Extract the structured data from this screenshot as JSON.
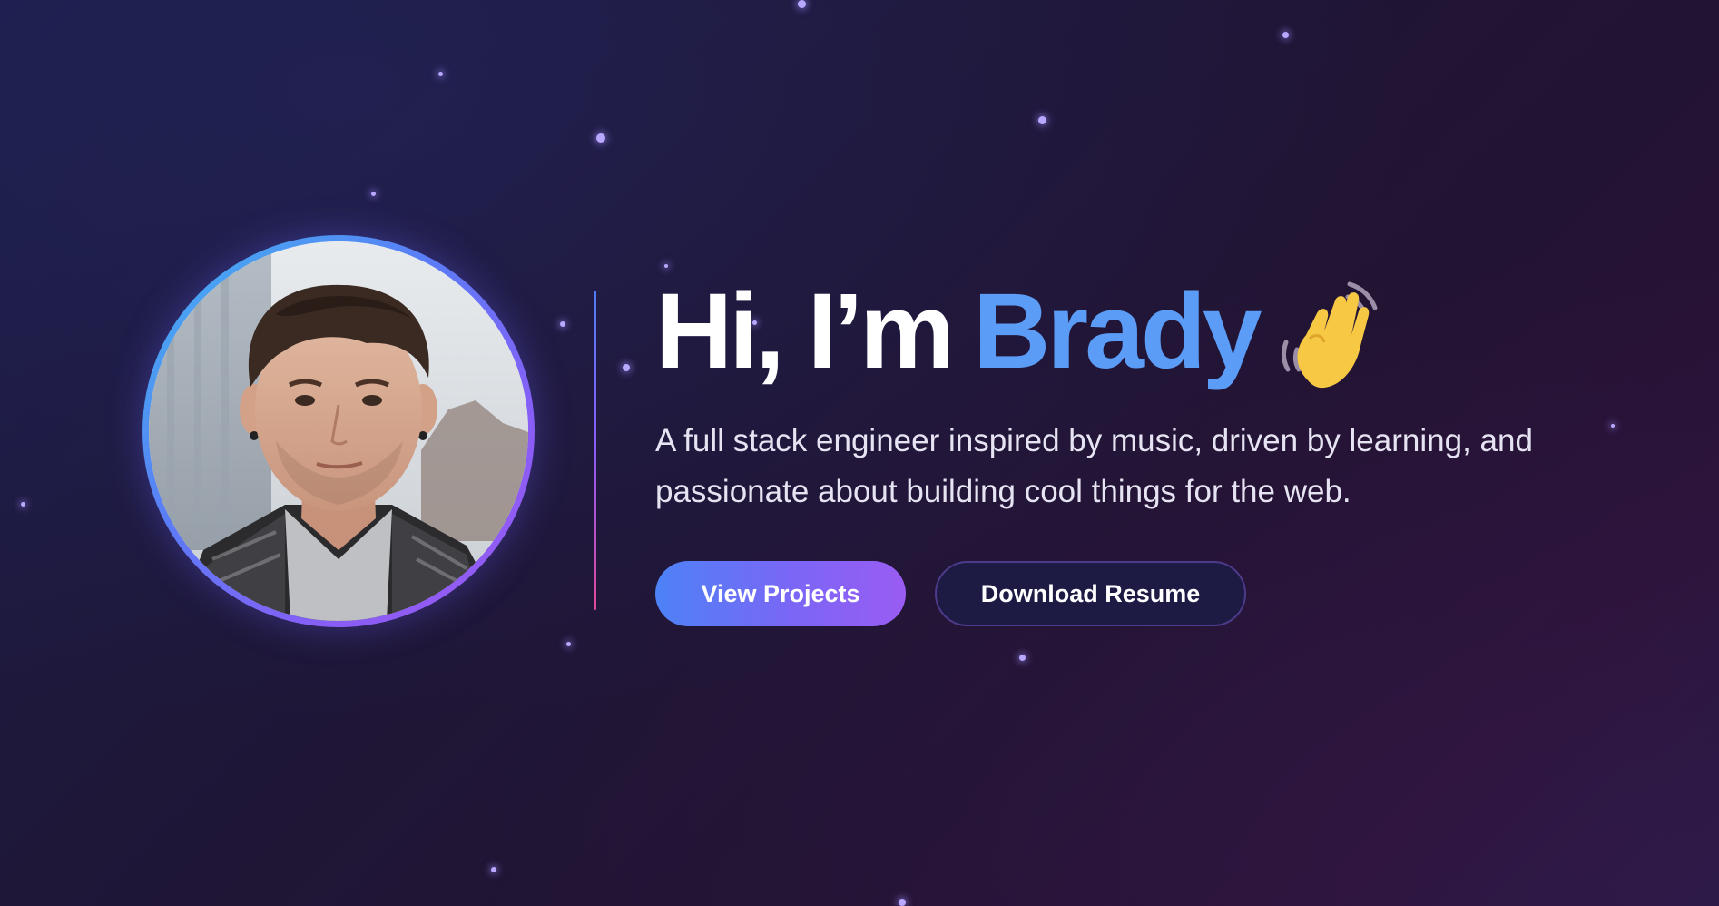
{
  "hero": {
    "greeting": "Hi, I’m",
    "name": "Brady",
    "wave_emoji": "waving-hand-icon",
    "tagline_line1": "A full stack engineer inspired by music, driven by learning, and",
    "tagline_line2": "passionate about building cool things for the web.",
    "primary_button": "View Projects",
    "secondary_button": "Download Resume"
  },
  "colors": {
    "name_accent": "#5b9cf6",
    "button_gradient_start": "#4d82f6",
    "button_gradient_end": "#9a5cf3",
    "divider_top": "#4f7df3",
    "divider_bottom": "#e14a9a"
  }
}
